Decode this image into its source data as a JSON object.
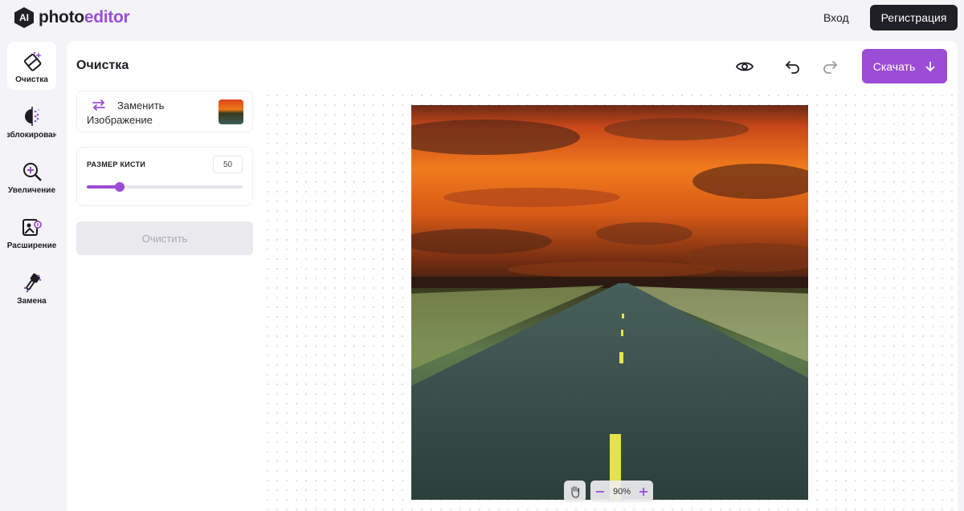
{
  "brand": {
    "badge": "AI",
    "name_part1": "photo",
    "name_part2": "editor"
  },
  "header": {
    "login": "Вход",
    "register": "Регистрация"
  },
  "tools": [
    {
      "label": "Очистка",
      "icon": "eraser-icon",
      "active": true
    },
    {
      "label": "Разблокирование",
      "icon": "blur-icon",
      "active": false
    },
    {
      "label": "Увеличение",
      "icon": "magnify-icon",
      "active": false
    },
    {
      "label": "Расширение",
      "icon": "expand-image-icon",
      "active": false
    },
    {
      "label": "Замена",
      "icon": "replace-brush-icon",
      "active": false
    }
  ],
  "panel": {
    "title": "Очистка",
    "download": "Скачать",
    "replace": {
      "line1": "Заменить",
      "line2": "Изображение"
    },
    "brush": {
      "label": "РАЗМЕР КИСТИ",
      "value": "50",
      "fraction": 0.21
    },
    "clear": "Очистить"
  },
  "zoom": {
    "value": "90%"
  },
  "colors": {
    "accent": "#9b4dd6",
    "dark": "#1f1f26"
  }
}
